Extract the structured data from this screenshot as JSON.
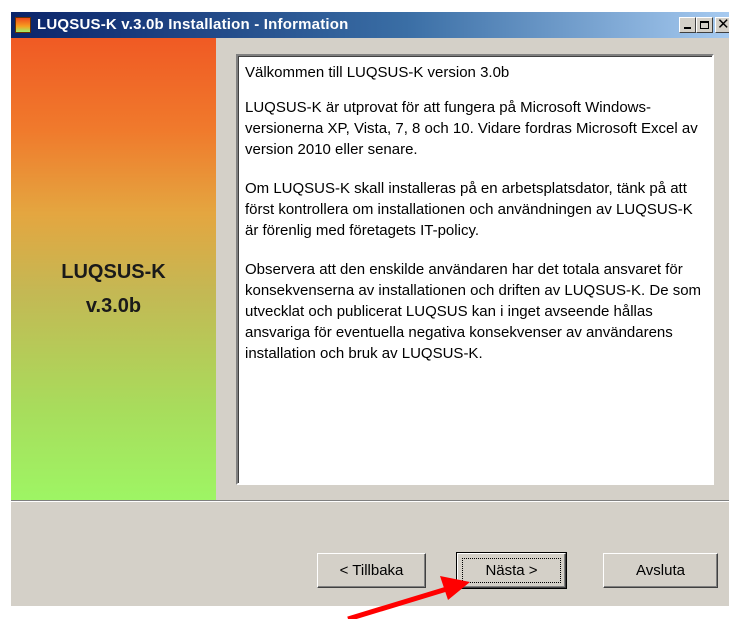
{
  "window": {
    "title": "LUQSUS-K v.3.0b Installation - Information",
    "controls": {
      "minimize": "_",
      "maximize": "□",
      "close": "✕"
    }
  },
  "side_panel": {
    "product_name": "LUQSUS-K",
    "version": "v.3.0b",
    "gradient_colors": [
      "#f05a24",
      "#e4a640",
      "#9ef564"
    ]
  },
  "content": {
    "paragraphs": [
      "Välkommen till LUQSUS-K version 3.0b",
      "LUQSUS-K är utprovat för att fungera på Microsoft Windows-versionerna XP, Vista, 7, 8 och 10. Vidare fordras Microsoft Excel av version 2010 eller senare.",
      "Om LUQSUS-K skall installeras på en arbetsplatsdator, tänk på att först kontrollera om installationen och användningen av LUQSUS-K är förenlig med företagets IT-policy.",
      "Observera att den enskilde användaren har det totala ansvaret för konsekvenserna av installationen och driften av LUQSUS-K. De som utvecklat och publicerat LUQSUS kan i inget avseende hållas ansvariga för eventuella negativa konsekvenser av användarens installation och bruk av LUQSUS-K."
    ]
  },
  "buttons": {
    "back": "< Tillbaka",
    "next": "Nästa >",
    "exit": "Avsluta"
  },
  "annotation": {
    "arrow_color": "#ff0000",
    "points_to": "next-button"
  }
}
